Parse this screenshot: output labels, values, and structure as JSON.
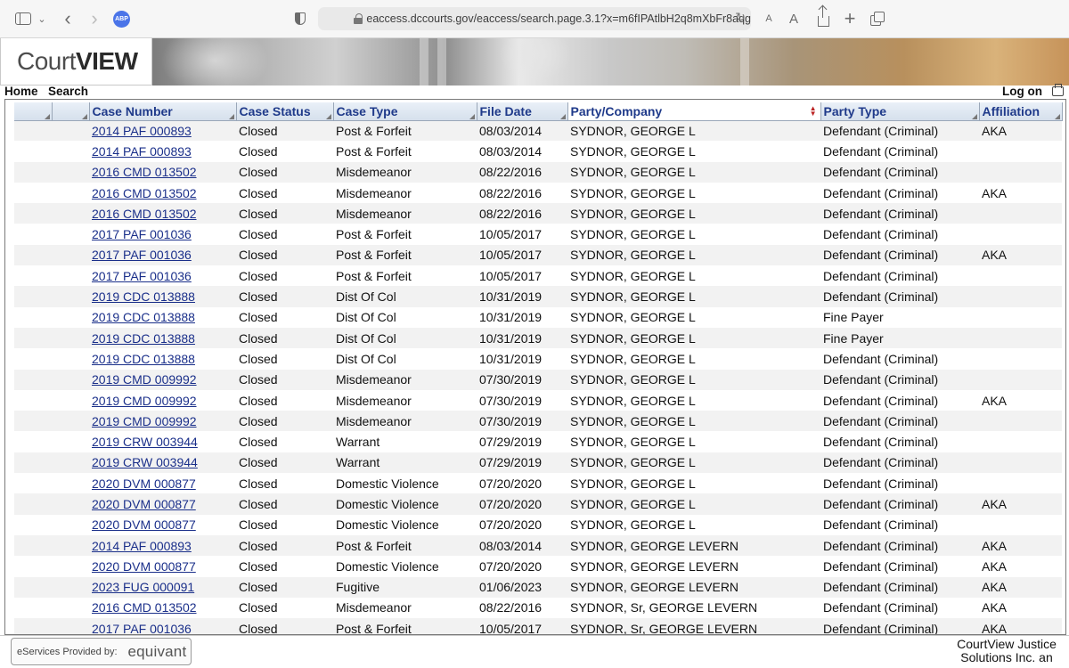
{
  "browser": {
    "url": "eaccess.dccourts.gov/eaccess/search.page.3.1?x=m6fIPAtlbH2q8mXbFr8aqg",
    "extension_badge": "ABP",
    "icons": [
      "sidebar-icon",
      "chevron-down-icon",
      "back-icon",
      "forward-icon",
      "adblock-icon",
      "shield-icon",
      "lock-icon",
      "reload-icon",
      "font-smaller-icon",
      "font-larger-icon",
      "share-icon",
      "new-tab-icon",
      "tabs-overview-icon"
    ]
  },
  "header": {
    "logo_part1": "Court",
    "logo_part2": "VIEW"
  },
  "nav": {
    "home": "Home",
    "search": "Search",
    "logon": "Log on"
  },
  "grid": {
    "columns": [
      "",
      "",
      "Case Number",
      "Case Status",
      "Case Type",
      "File Date",
      "Party/Company",
      "Party Type",
      "Affiliation"
    ],
    "sorted_column": "Party/Company",
    "rows": [
      [
        "2014 PAF 000893",
        "Closed",
        "Post & Forfeit",
        "08/03/2014",
        "SYDNOR, GEORGE L",
        "Defendant (Criminal)",
        "AKA"
      ],
      [
        "2014 PAF 000893",
        "Closed",
        "Post & Forfeit",
        "08/03/2014",
        "SYDNOR, GEORGE L",
        "Defendant (Criminal)",
        ""
      ],
      [
        "2016 CMD 013502",
        "Closed",
        "Misdemeanor",
        "08/22/2016",
        "SYDNOR, GEORGE L",
        "Defendant (Criminal)",
        ""
      ],
      [
        "2016 CMD 013502",
        "Closed",
        "Misdemeanor",
        "08/22/2016",
        "SYDNOR, GEORGE L",
        "Defendant (Criminal)",
        "AKA"
      ],
      [
        "2016 CMD 013502",
        "Closed",
        "Misdemeanor",
        "08/22/2016",
        "SYDNOR, GEORGE L",
        "Defendant (Criminal)",
        ""
      ],
      [
        "2017 PAF 001036",
        "Closed",
        "Post & Forfeit",
        "10/05/2017",
        "SYDNOR, GEORGE L",
        "Defendant (Criminal)",
        ""
      ],
      [
        "2017 PAF 001036",
        "Closed",
        "Post & Forfeit",
        "10/05/2017",
        "SYDNOR, GEORGE L",
        "Defendant (Criminal)",
        "AKA"
      ],
      [
        "2017 PAF 001036",
        "Closed",
        "Post & Forfeit",
        "10/05/2017",
        "SYDNOR, GEORGE L",
        "Defendant (Criminal)",
        ""
      ],
      [
        "2019 CDC 013888",
        "Closed",
        "Dist Of Col",
        "10/31/2019",
        "SYDNOR, GEORGE L",
        "Defendant (Criminal)",
        ""
      ],
      [
        "2019 CDC 013888",
        "Closed",
        "Dist Of Col",
        "10/31/2019",
        "SYDNOR, GEORGE L",
        "Fine Payer",
        ""
      ],
      [
        "2019 CDC 013888",
        "Closed",
        "Dist Of Col",
        "10/31/2019",
        "SYDNOR, GEORGE L",
        "Fine Payer",
        ""
      ],
      [
        "2019 CDC 013888",
        "Closed",
        "Dist Of Col",
        "10/31/2019",
        "SYDNOR, GEORGE L",
        "Defendant (Criminal)",
        ""
      ],
      [
        "2019 CMD 009992",
        "Closed",
        "Misdemeanor",
        "07/30/2019",
        "SYDNOR, GEORGE L",
        "Defendant (Criminal)",
        ""
      ],
      [
        "2019 CMD 009992",
        "Closed",
        "Misdemeanor",
        "07/30/2019",
        "SYDNOR, GEORGE L",
        "Defendant (Criminal)",
        "AKA"
      ],
      [
        "2019 CMD 009992",
        "Closed",
        "Misdemeanor",
        "07/30/2019",
        "SYDNOR, GEORGE L",
        "Defendant (Criminal)",
        ""
      ],
      [
        "2019 CRW 003944",
        "Closed",
        "Warrant",
        "07/29/2019",
        "SYDNOR, GEORGE L",
        "Defendant (Criminal)",
        ""
      ],
      [
        "2019 CRW 003944",
        "Closed",
        "Warrant",
        "07/29/2019",
        "SYDNOR, GEORGE L",
        "Defendant (Criminal)",
        ""
      ],
      [
        "2020 DVM 000877",
        "Closed",
        "Domestic Violence",
        "07/20/2020",
        "SYDNOR, GEORGE L",
        "Defendant (Criminal)",
        ""
      ],
      [
        "2020 DVM 000877",
        "Closed",
        "Domestic Violence",
        "07/20/2020",
        "SYDNOR, GEORGE L",
        "Defendant (Criminal)",
        "AKA"
      ],
      [
        "2020 DVM 000877",
        "Closed",
        "Domestic Violence",
        "07/20/2020",
        "SYDNOR, GEORGE L",
        "Defendant (Criminal)",
        ""
      ],
      [
        "2014 PAF 000893",
        "Closed",
        "Post & Forfeit",
        "08/03/2014",
        "SYDNOR, GEORGE LEVERN",
        "Defendant (Criminal)",
        "AKA"
      ],
      [
        "2020 DVM 000877",
        "Closed",
        "Domestic Violence",
        "07/20/2020",
        "SYDNOR, GEORGE LEVERN",
        "Defendant (Criminal)",
        "AKA"
      ],
      [
        "2023 FUG 000091",
        "Closed",
        "Fugitive",
        "01/06/2023",
        "SYDNOR, GEORGE LEVERN",
        "Defendant (Criminal)",
        "AKA"
      ],
      [
        "2016 CMD 013502",
        "Closed",
        "Misdemeanor",
        "08/22/2016",
        "SYDNOR, Sr, GEORGE LEVERN",
        "Defendant (Criminal)",
        "AKA"
      ],
      [
        "2017 PAF 001036",
        "Closed",
        "Post & Forfeit",
        "10/05/2017",
        "SYDNOR, Sr, GEORGE LEVERN",
        "Defendant (Criminal)",
        "AKA"
      ]
    ]
  },
  "footer": {
    "eservices_label": "eServices Provided by:",
    "provider_logo": "equivant",
    "credit": "CourtView Justice Solutions Inc. an"
  }
}
